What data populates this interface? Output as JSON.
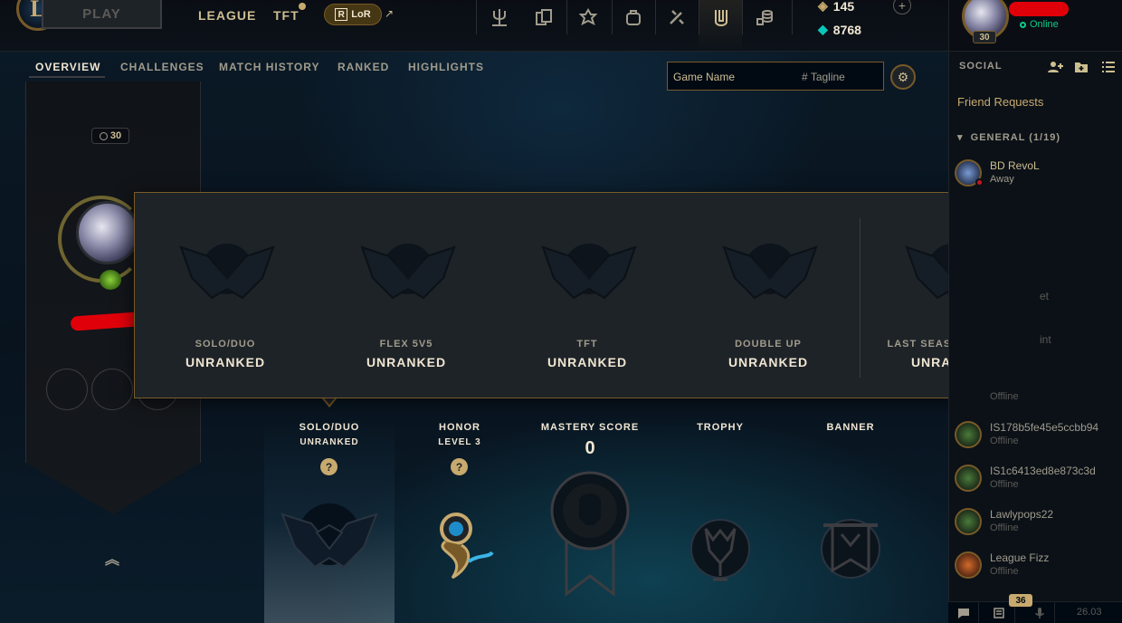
{
  "topnav": {
    "play_label": "PLAY",
    "league_label": "LEAGUE",
    "tft_label": "TFT",
    "lor_label": "LoR",
    "lor_letter": "R",
    "rp_amount": "145",
    "be_amount": "8768",
    "icons": [
      "trident-icon",
      "cards-icon",
      "crest-icon",
      "backpack-icon",
      "crafting-icon",
      "collection-icon",
      "store-icon"
    ]
  },
  "subnav": {
    "items": [
      "OVERVIEW",
      "CHALLENGES",
      "MATCH HISTORY",
      "RANKED",
      "HIGHLIGHTS"
    ],
    "active": "OVERVIEW"
  },
  "search": {
    "name_placeholder": "Game Name",
    "tag_placeholder": "Tagline",
    "hash": "#"
  },
  "banner": {
    "level": "30"
  },
  "ranked_popup": {
    "columns": [
      {
        "queue": "SOLO/DUO",
        "tier": "UNRANKED"
      },
      {
        "queue": "FLEX 5V5",
        "tier": "UNRANKED"
      },
      {
        "queue": "TFT",
        "tier": "UNRANKED"
      },
      {
        "queue": "DOUBLE UP",
        "tier": "UNRANKED"
      },
      {
        "queue": "LAST SEASON'S RANK",
        "tier": "UNRANKED"
      }
    ]
  },
  "showcase": {
    "solo": {
      "title": "SOLO/DUO",
      "sub": "UNRANKED",
      "help": "?"
    },
    "honor": {
      "title": "HONOR",
      "sub": "LEVEL 3",
      "help": "?"
    },
    "mastery": {
      "title": "MASTERY SCORE",
      "value": "0"
    },
    "trophy": {
      "title": "TROPHY"
    },
    "banner": {
      "title": "BANNER"
    }
  },
  "social": {
    "me_level": "30",
    "me_status": "Online",
    "label": "SOCIAL",
    "friend_requests": "Friend Requests",
    "group_header": "GENERAL (1/19)",
    "friends": [
      {
        "name": "BD RevoL",
        "state": "Away"
      },
      {
        "name": "IS178b5fe45e5ccbb94",
        "state": "Offline"
      },
      {
        "name": "IS1c6413ed8e873c3d",
        "state": "Offline"
      },
      {
        "name": "Lawlypops22",
        "state": "Offline"
      },
      {
        "name": "League Fizz",
        "state": "Offline"
      }
    ],
    "peek": [
      "et",
      "int",
      "Offline"
    ]
  },
  "dock": {
    "badge": "36",
    "version": "26.03"
  },
  "colors": {
    "gold": "#c8aa6e",
    "gold_dark": "#785a28",
    "text_light": "#f0e6d2",
    "online": "#0acb8a",
    "panel": "#1e2328"
  }
}
